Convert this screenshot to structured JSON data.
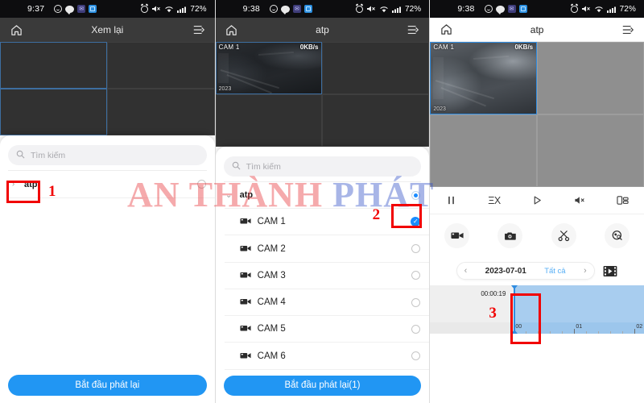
{
  "status_bar": {
    "times": [
      "9:37",
      "9:38",
      "9:38"
    ],
    "battery": "72%",
    "icons_left": [
      "alarm-circle-icon",
      "chat-bubble-icon",
      "app-purple-icon",
      "app-blue-icon"
    ],
    "icons_right": [
      "alarm-clock-icon",
      "mute-icon",
      "wifi-icon",
      "signal-icon",
      "battery-percent"
    ]
  },
  "panels": [
    {
      "header": {
        "title": "Xem lại",
        "home_icon": "home-icon",
        "menu_icon": "list-menu-icon",
        "theme": "dark"
      },
      "video": {
        "theme": "dark",
        "cells": 4,
        "active_cell": 0,
        "label": "",
        "rate": "",
        "stamp": ""
      },
      "sheet": {
        "search_placeholder": "Tìm kiếm",
        "rows": [
          {
            "type": "group",
            "chevron": "›",
            "label": "atp",
            "state": "circle"
          }
        ],
        "cta_label": "Bắt đầu phát lại"
      },
      "annotations": [
        {
          "label": "1",
          "box": true
        }
      ]
    },
    {
      "header": {
        "title": "atp",
        "home_icon": "home-icon",
        "menu_icon": "list-menu-icon",
        "theme": "dark"
      },
      "video": {
        "theme": "dark",
        "cells": 4,
        "active_cell": 0,
        "label": "CAM 1",
        "rate": "0KB/s",
        "stamp": "2023"
      },
      "sheet": {
        "search_placeholder": "Tìm kiếm",
        "rows": [
          {
            "type": "group",
            "chevron": "⌄",
            "label": "atp",
            "state": "ring"
          },
          {
            "type": "camera",
            "icon": "camcorder-icon",
            "label": "CAM 1",
            "state": "checked"
          },
          {
            "type": "camera",
            "icon": "camcorder-icon",
            "label": "CAM 2",
            "state": "circle"
          },
          {
            "type": "camera",
            "icon": "camcorder-icon",
            "label": "CAM 3",
            "state": "circle"
          },
          {
            "type": "camera",
            "icon": "camcorder-icon",
            "label": "CAM 4",
            "state": "circle"
          },
          {
            "type": "camera",
            "icon": "camcorder-icon",
            "label": "CAM 5",
            "state": "circle"
          },
          {
            "type": "camera",
            "icon": "camcorder-icon",
            "label": "CAM 6",
            "state": "circle"
          }
        ],
        "cta_label": "Bắt đầu phát lại(1)"
      },
      "annotations": [
        {
          "label": "2",
          "box": true
        }
      ]
    },
    {
      "header": {
        "title": "atp",
        "home_icon": "home-icon",
        "menu_icon": "list-menu-icon",
        "theme": "light"
      },
      "video": {
        "theme": "light",
        "cells": 4,
        "active_cell": 0,
        "label": "CAM 1",
        "rate": "0KB/s",
        "stamp": "2023"
      },
      "controls": {
        "transport": [
          {
            "name": "pause-icon",
            "glyph": "pause"
          },
          {
            "name": "playback-speed-icon",
            "glyph": "ΞX"
          },
          {
            "name": "play-icon",
            "glyph": "play"
          },
          {
            "name": "mute-icon",
            "glyph": "mute"
          },
          {
            "name": "split-screen-icon",
            "glyph": "split"
          }
        ],
        "actions": [
          {
            "name": "record-video-button",
            "glyph": "camcorder"
          },
          {
            "name": "snapshot-button",
            "glyph": "camera"
          },
          {
            "name": "clip-button",
            "glyph": "scissors"
          },
          {
            "name": "tag-search-button",
            "glyph": "tagsearch"
          }
        ],
        "date_bar": {
          "prev": "‹",
          "date": "2023-07-01",
          "all_label": "Tất cả",
          "next": "›",
          "film_icon": "film-strip-icon"
        },
        "timeline": {
          "current_time": "00:00:19",
          "ruler_labels": [
            "00",
            "01",
            "02"
          ],
          "playhead_icon": "playhead-marker"
        }
      },
      "annotations": [
        {
          "label": "3",
          "box": true
        }
      ]
    }
  ],
  "watermark": {
    "part_a": "AN THÀNH ",
    "part_b": "PHÁT",
    "color_a": "#e8373c",
    "color_b": "#3250c8"
  },
  "annotation_color": "#f10000"
}
